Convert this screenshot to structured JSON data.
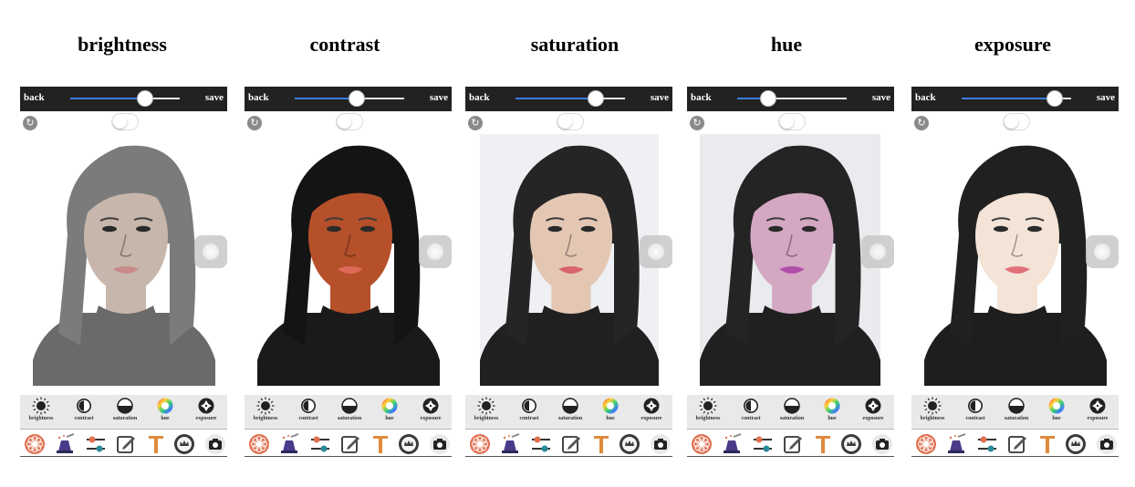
{
  "captions": [
    "brightness",
    "contrast",
    "saturation",
    "hue",
    "exposure"
  ],
  "topbar": {
    "back_label": "back",
    "save_label": "save"
  },
  "panels": [
    {
      "slider_value": 0.68
    },
    {
      "slider_value": 0.57
    },
    {
      "slider_value": 0.73
    },
    {
      "slider_value": 0.28
    },
    {
      "slider_value": 0.85
    }
  ],
  "adjustments": [
    {
      "label": "brightness",
      "icon": "sun-icon"
    },
    {
      "label": "contrast",
      "icon": "contrast-icon"
    },
    {
      "label": "saturation",
      "icon": "half-circle-icon"
    },
    {
      "label": "hue",
      "icon": "color-wheel-icon"
    },
    {
      "label": "exposure",
      "icon": "aperture-icon"
    }
  ],
  "tools": [
    "flower-icon",
    "magic-hat-icon",
    "sliders-icon",
    "edit-icon",
    "text-icon",
    "crown-badge-icon",
    "camera-icon"
  ],
  "colors": {
    "topbar": "#222222",
    "slider_fill": "#3b7ddd",
    "tool_accent": "#e0704f"
  }
}
